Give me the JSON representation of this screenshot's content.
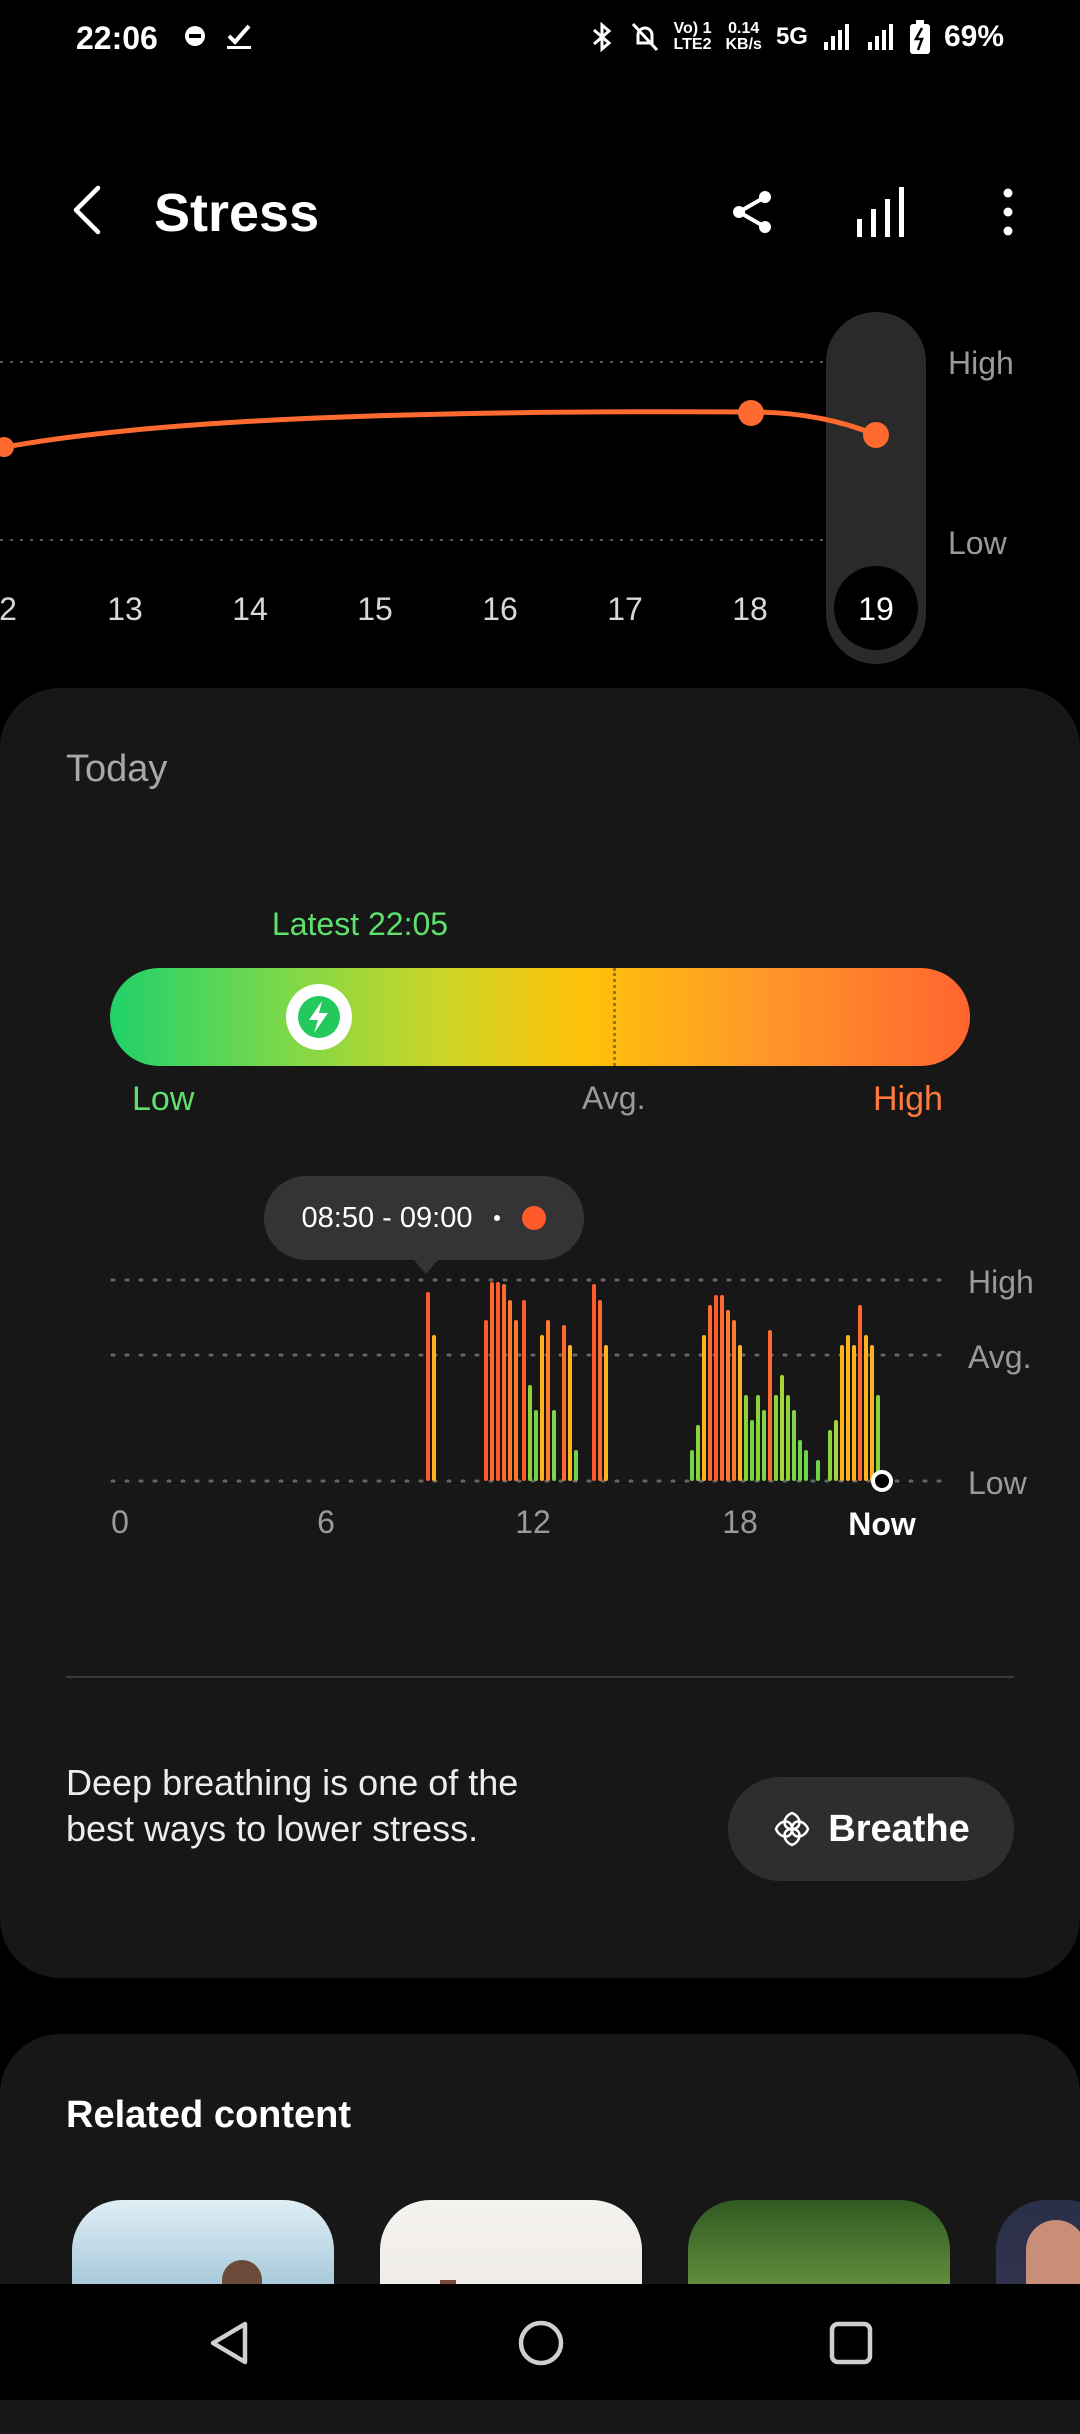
{
  "status_bar": {
    "time": "22:06",
    "net_top": "Vo) 1",
    "net_bottom": "LTE2",
    "speed_value": "0.14",
    "speed_unit": "KB/s",
    "network": "5G",
    "battery": "69%"
  },
  "header": {
    "title": "Stress"
  },
  "week_chart": {
    "days": [
      "2",
      "13",
      "14",
      "15",
      "16",
      "17",
      "18",
      "19"
    ],
    "selected_day": "19",
    "level_high": "High",
    "level_low": "Low"
  },
  "today": {
    "title": "Today",
    "latest": "Latest 22:05",
    "gauge_low": "Low",
    "gauge_avg": "Avg.",
    "gauge_high": "High",
    "tooltip_range": "08:50 - 09:00",
    "axis_labels": [
      "0",
      "6",
      "12",
      "18"
    ],
    "axis_now": "Now",
    "level_high": "High",
    "level_avg": "Avg.",
    "level_low": "Low",
    "tip": "Deep breathing is one of the best ways to lower stress.",
    "breathe_label": "Breathe"
  },
  "related": {
    "title": "Related content"
  },
  "colors": {
    "accent_orange": "#ff6a30",
    "low_green": "#5ee06e",
    "card_bg": "#171717"
  }
}
